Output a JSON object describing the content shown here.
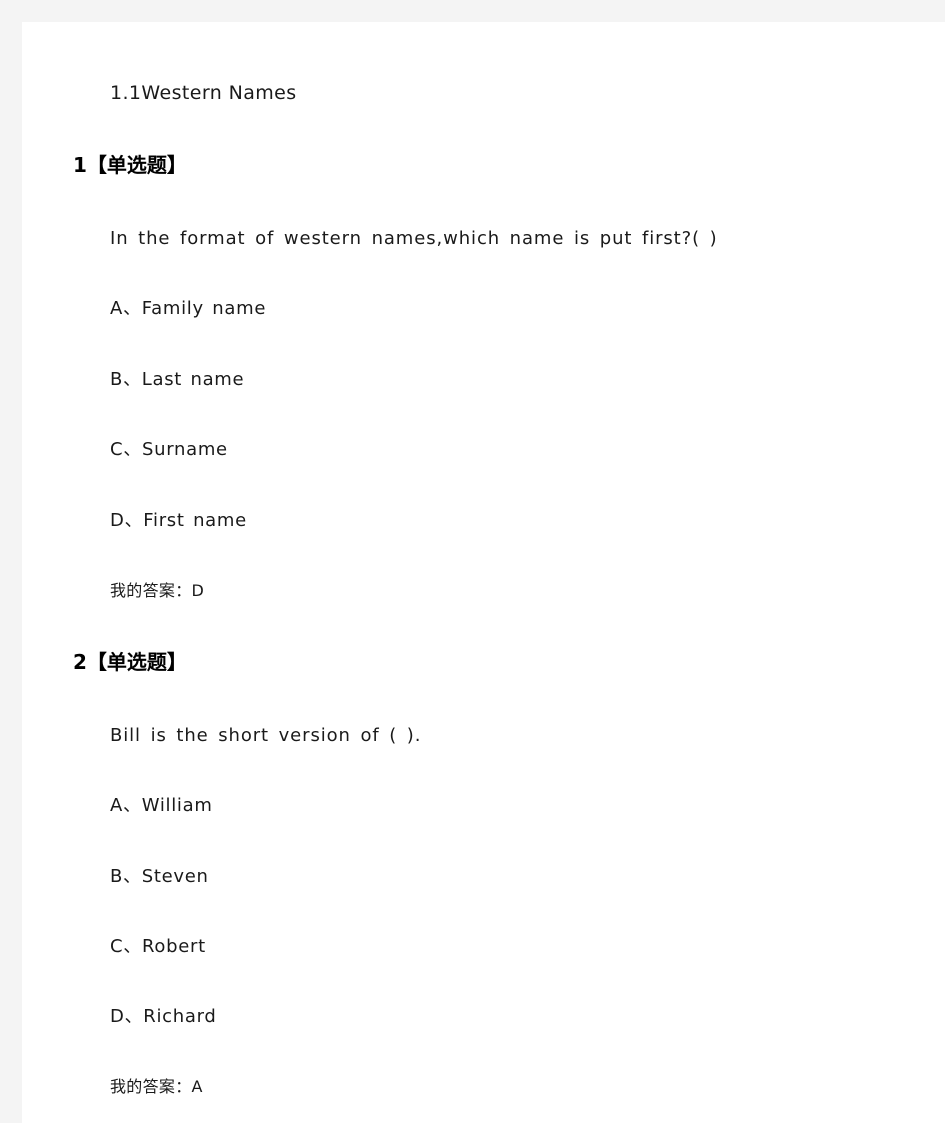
{
  "document": {
    "section_title": "1.1Western Names",
    "questions": [
      {
        "header": "1【单选题】",
        "stem": "In the format of western names,which name is put first?( )",
        "choices": [
          "A、Family name",
          "B、Last name",
          "C、Surname",
          "D、First name"
        ],
        "my_answer": "我的答案：D"
      },
      {
        "header": "2【单选题】",
        "stem": "Bill is the short version of ( ).",
        "choices": [
          "A、William",
          "B、Steven",
          "C、Robert",
          "D、Richard"
        ],
        "my_answer": "我的答案：A"
      }
    ]
  },
  "colors": {
    "page_background": "#ffffff",
    "frame_background": "#f4f4f4",
    "text": "#1a1a1a",
    "heading_text": "#000000"
  }
}
